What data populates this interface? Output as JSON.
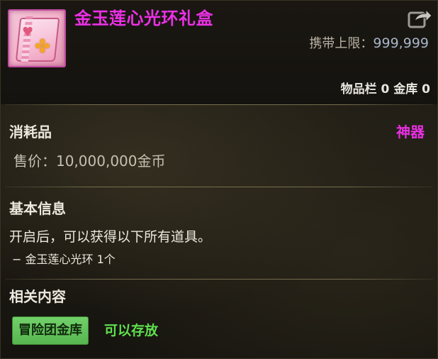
{
  "item": {
    "name": "金玉莲心光环礼盒",
    "icon": "pink-gift-bag-clover-icon",
    "carry_limit_label": "携带上限：",
    "carry_limit_value": "999,999",
    "storage_text": "物品栏 0 金库 0"
  },
  "basic": {
    "type": "消耗品",
    "rarity": "神器",
    "price": "售价：10,000,000金币"
  },
  "info": {
    "title": "基本信息",
    "description": "开启后，可以获得以下所有道具。",
    "contents": "− 金玉莲心光环 1个"
  },
  "related": {
    "title": "相关内容",
    "tag_button": "冒险团金库",
    "storable_text": "可以存放"
  },
  "colors": {
    "item_name": "#ec30e6",
    "rarity": "#e930e3",
    "storable": "#5fe04f",
    "tag_button_bg": "#66c45e"
  }
}
